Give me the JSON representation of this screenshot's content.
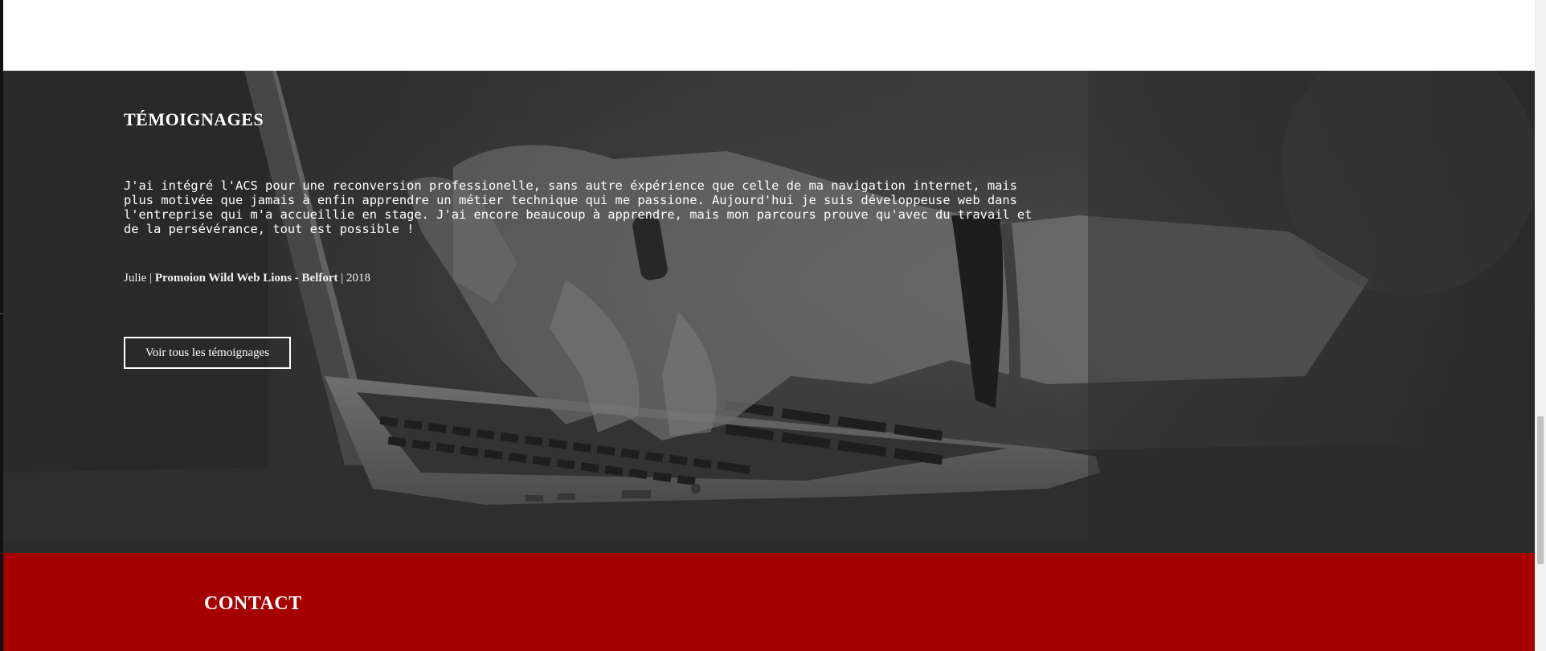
{
  "testimonials": {
    "title": "TÉMOIGNAGES",
    "quote": "J'ai intégré l'ACS pour une reconversion professionelle, sans autre éxpérience que celle de ma navigation internet, mais plus motivée que jamais à enfin apprendre un métier technique qui me passione. Aujourd'hui je suis développeuse web dans l'entreprise qui m'a accueillie en stage. J'ai encore beaucoup à apprendre, mais mon parcours prouve qu'avec du travail et de la persévérance, tout est possible !",
    "author_name": "Julie",
    "separator": " | ",
    "promotion": "Promoion Wild Web Lions - Belfort",
    "year": "2018",
    "cta_label": "Voir tous les témoignages"
  },
  "contact": {
    "title": "CONTACT"
  },
  "colors": {
    "contact_background": "#a40000",
    "text": "#ffffff"
  },
  "background_image": "grayscale-hands-typing-on-laptop-photo"
}
